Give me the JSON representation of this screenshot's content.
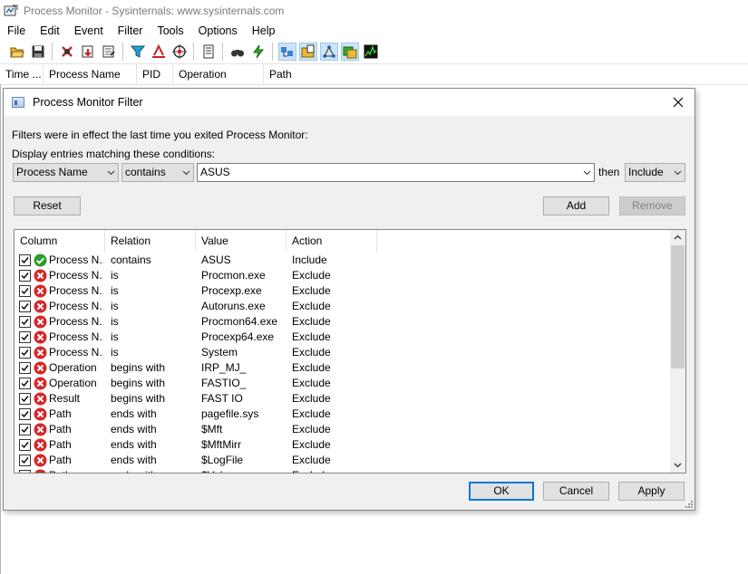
{
  "window": {
    "title": "Process Monitor - Sysinternals: www.sysinternals.com"
  },
  "menu": [
    "File",
    "Edit",
    "Event",
    "Filter",
    "Tools",
    "Options",
    "Help"
  ],
  "toolbar": {
    "buttons": [
      "open-icon",
      "save-icon",
      "capture-icon",
      "autoscroll-icon",
      "clear-icon",
      "filter-icon",
      "highlight-icon",
      "target-icon",
      "process-tree-icon",
      "find-icon",
      "jump-icon",
      "registry-activity-icon",
      "file-activity-icon",
      "network-activity-icon",
      "process-activity-icon",
      "profiling-icon"
    ]
  },
  "columns": [
    "Time ...",
    "Process Name",
    "PID",
    "Operation",
    "Path"
  ],
  "dialog": {
    "title": "Process Monitor Filter",
    "info": "Filters were in effect the last time you exited Process Monitor:",
    "display_label": "Display entries matching these conditions:",
    "column_combo": "Process Name",
    "relation_combo": "contains",
    "value_combo": "ASUS",
    "then_label": "then",
    "action_combo": "Include",
    "reset": "Reset",
    "add": "Add",
    "remove": "Remove",
    "ok": "OK",
    "cancel": "Cancel",
    "apply": "Apply",
    "list_headers": [
      "Column",
      "Relation",
      "Value",
      "Action"
    ],
    "rows": [
      {
        "column": "Process N...",
        "relation": "contains",
        "value": "ASUS",
        "action": "Include",
        "status": "include"
      },
      {
        "column": "Process N...",
        "relation": "is",
        "value": "Procmon.exe",
        "action": "Exclude",
        "status": "exclude"
      },
      {
        "column": "Process N...",
        "relation": "is",
        "value": "Procexp.exe",
        "action": "Exclude",
        "status": "exclude"
      },
      {
        "column": "Process N...",
        "relation": "is",
        "value": "Autoruns.exe",
        "action": "Exclude",
        "status": "exclude"
      },
      {
        "column": "Process N...",
        "relation": "is",
        "value": "Procmon64.exe",
        "action": "Exclude",
        "status": "exclude"
      },
      {
        "column": "Process N...",
        "relation": "is",
        "value": "Procexp64.exe",
        "action": "Exclude",
        "status": "exclude"
      },
      {
        "column": "Process N...",
        "relation": "is",
        "value": "System",
        "action": "Exclude",
        "status": "exclude"
      },
      {
        "column": "Operation",
        "relation": "begins with",
        "value": "IRP_MJ_",
        "action": "Exclude",
        "status": "exclude"
      },
      {
        "column": "Operation",
        "relation": "begins with",
        "value": "FASTIO_",
        "action": "Exclude",
        "status": "exclude"
      },
      {
        "column": "Result",
        "relation": "begins with",
        "value": "FAST IO",
        "action": "Exclude",
        "status": "exclude"
      },
      {
        "column": "Path",
        "relation": "ends with",
        "value": "pagefile.sys",
        "action": "Exclude",
        "status": "exclude"
      },
      {
        "column": "Path",
        "relation": "ends with",
        "value": "$Mft",
        "action": "Exclude",
        "status": "exclude"
      },
      {
        "column": "Path",
        "relation": "ends with",
        "value": "$MftMirr",
        "action": "Exclude",
        "status": "exclude"
      },
      {
        "column": "Path",
        "relation": "ends with",
        "value": "$LogFile",
        "action": "Exclude",
        "status": "exclude"
      },
      {
        "column": "Path",
        "relation": "ends with",
        "value": "$Volume",
        "action": "Exclude",
        "status": "exclude"
      }
    ]
  },
  "colors": {
    "accent": "#0078d7",
    "include": "#2e9b2e",
    "exclude": "#d8262a"
  }
}
